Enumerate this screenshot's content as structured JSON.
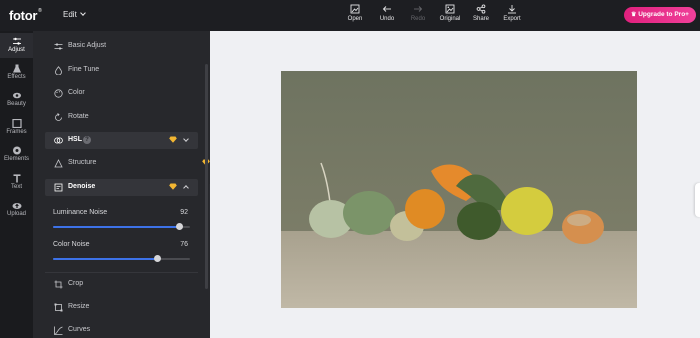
{
  "brand": {
    "logo": "fotor",
    "mark": "®"
  },
  "header": {
    "edit_label": "Edit",
    "tools": [
      {
        "label": "Open",
        "icon": "image-icon",
        "disabled": false
      },
      {
        "label": "Undo",
        "icon": "undo-arrow-icon",
        "disabled": false
      },
      {
        "label": "Redo",
        "icon": "redo-arrow-icon",
        "disabled": true
      },
      {
        "label": "Original",
        "icon": "image-compare-icon",
        "disabled": false
      },
      {
        "label": "Share",
        "icon": "share-icon",
        "disabled": false
      },
      {
        "label": "Export",
        "icon": "download-icon",
        "disabled": false
      }
    ],
    "upgrade_label": "Upgrade to Pro+"
  },
  "rail": {
    "items": [
      {
        "label": "Adjust",
        "icon": "sliders-icon",
        "active": true
      },
      {
        "label": "Effects",
        "icon": "flask-icon",
        "active": false
      },
      {
        "label": "Beauty",
        "icon": "eye-icon",
        "active": false
      },
      {
        "label": "Frames",
        "icon": "frame-icon",
        "active": false
      },
      {
        "label": "Elements",
        "icon": "shapes-icon",
        "active": false
      },
      {
        "label": "Text",
        "icon": "text-icon",
        "active": false
      },
      {
        "label": "Upload",
        "icon": "cloud-upload-icon",
        "active": false
      }
    ]
  },
  "panel": {
    "sections": [
      {
        "label": "Basic Adjust",
        "icon": "sliders-icon"
      },
      {
        "label": "Fine Tune",
        "icon": "drop-icon"
      },
      {
        "label": "Color",
        "icon": "palette-icon"
      },
      {
        "label": "Rotate",
        "icon": "rotate-icon"
      },
      {
        "label": "HSL",
        "icon": "circles-icon",
        "pro": true,
        "help": "?"
      },
      {
        "label": "Structure",
        "icon": "triangle-icon",
        "pro": true
      },
      {
        "label": "Denoise",
        "icon": "denoise-icon",
        "pro": true,
        "expanded": true
      },
      {
        "label": "Crop",
        "icon": "crop-icon"
      },
      {
        "label": "Resize",
        "icon": "resize-icon"
      },
      {
        "label": "Curves",
        "icon": "curve-icon"
      }
    ],
    "denoise": {
      "luminance_label": "Luminance Noise",
      "luminance_value": "92",
      "color_label": "Color Noise",
      "color_value": "76"
    }
  },
  "colors": {
    "accent": "#3d72e8",
    "upgrade": "#e0207d",
    "pro_gem": "#f2b632"
  }
}
